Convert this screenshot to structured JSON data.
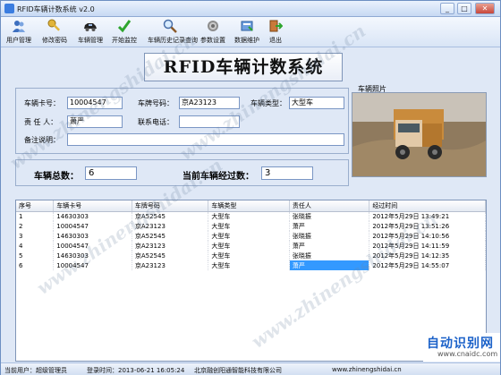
{
  "window": {
    "title": "RFID车辆计数系统 v2.0",
    "min_label": "0",
    "max_label": "1",
    "close_label": "r"
  },
  "toolbar": [
    {
      "label": "用户管理",
      "icon": "users-icon"
    },
    {
      "label": "修改密码",
      "icon": "key-icon"
    },
    {
      "label": "车辆管理",
      "icon": "car-icon"
    },
    {
      "label": "开始监控",
      "icon": "checkmark-icon"
    },
    {
      "label": "车辆历史记录查询",
      "icon": "magnifier-icon"
    },
    {
      "label": "参数设置",
      "icon": "gear-icon"
    },
    {
      "label": "数据维护",
      "icon": "database-icon"
    },
    {
      "label": "退出",
      "icon": "exit-icon"
    }
  ],
  "banner": "RFID车辆计数系统",
  "form": {
    "card_label": "车辆卡号：",
    "card_value": "10004547",
    "plate_label": "车牌号码：",
    "plate_value": "京A23123",
    "type_label": "车辆类型：",
    "type_value": "大型车",
    "person_label": "责 任 人：",
    "person_value": "萧严",
    "phone_label": "联系电话：",
    "phone_value": "",
    "note_label": "备注说明：",
    "note_value": ""
  },
  "photo_label": "车辆照片",
  "counts": {
    "total_label": "车辆总数：",
    "total_value": "6",
    "passed_label": "当前车辆经过数：",
    "passed_value": "3"
  },
  "table": {
    "headers": [
      "序号",
      "车辆卡号",
      "车牌号码",
      "车辆类型",
      "责任人",
      "经过时间"
    ],
    "rows": [
      [
        "1",
        "14630303",
        "京A52545",
        "大型车",
        "张晓振",
        "2012年5月29日 13:49:21"
      ],
      [
        "2",
        "10004547",
        "京A23123",
        "大型车",
        "萧严",
        "2012年5月29日 13:51:26"
      ],
      [
        "3",
        "14630303",
        "京A52545",
        "大型车",
        "张晓振",
        "2012年5月29日 14:10:56"
      ],
      [
        "4",
        "10004547",
        "京A23123",
        "大型车",
        "萧严",
        "2012年5月29日 14:11:59"
      ],
      [
        "5",
        "14630303",
        "京A52545",
        "大型车",
        "张晓振",
        "2012年5月29日 14:12:35"
      ],
      [
        "6",
        "10004547",
        "京A23123",
        "大型车",
        "萧严",
        "2012年5月29日 14:55:07"
      ]
    ],
    "selected_row": 6
  },
  "status": {
    "user_info": "当前用户：超级管理员",
    "login_time": "登录时间：2013-06-21 16:05:24",
    "company": "北京融创阳通智能科技有限公司",
    "website": "www.zhinengshidai.cn"
  },
  "watermark_text": "www.zhinengshidai.cn",
  "logo": {
    "title": "自动识别网",
    "url": "www.cnaidc.com"
  },
  "colors": {
    "selection": "#3399ff",
    "logo_blue": "#1c62c9"
  }
}
